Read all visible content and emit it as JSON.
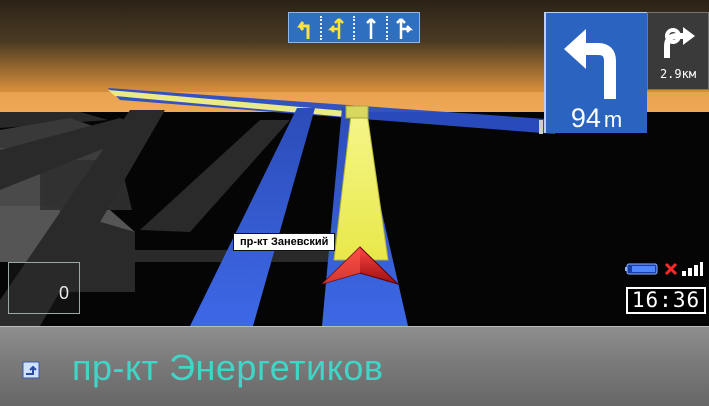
{
  "navigation": {
    "lane_guidance": {
      "lanes": [
        {
          "icon": "lane-left-turn-icon",
          "active": true
        },
        {
          "icon": "lane-straight-left-icon",
          "active": true
        },
        {
          "icon": "lane-straight-icon",
          "active": false
        },
        {
          "icon": "lane-straight-right-icon",
          "active": false
        }
      ]
    },
    "maneuver": {
      "icon": "turn-left-arrow-icon",
      "distance_value": "94",
      "distance_unit": "m"
    },
    "next_maneuver": {
      "icon": "turn-right-arrow-icon",
      "distance": "2.9км"
    },
    "map": {
      "street_label": "пр-кт Заневский"
    },
    "speed": {
      "value": "0"
    },
    "status": {
      "battery_icon": "battery-icon",
      "gps_icon": "gps-no-signal-icon",
      "signal_icon": "signal-bars-icon",
      "time": "16:36"
    },
    "bottom_bar": {
      "current_street": "пр-кт Энергетиков",
      "icon": "street-icon"
    }
  },
  "colors": {
    "route_yellow": "#f3f36a",
    "road_blue": "#2d56c8",
    "panel_blue": "#2a63c0",
    "street_text": "#3fd6c8",
    "cursor_red": "#d81b1b"
  }
}
